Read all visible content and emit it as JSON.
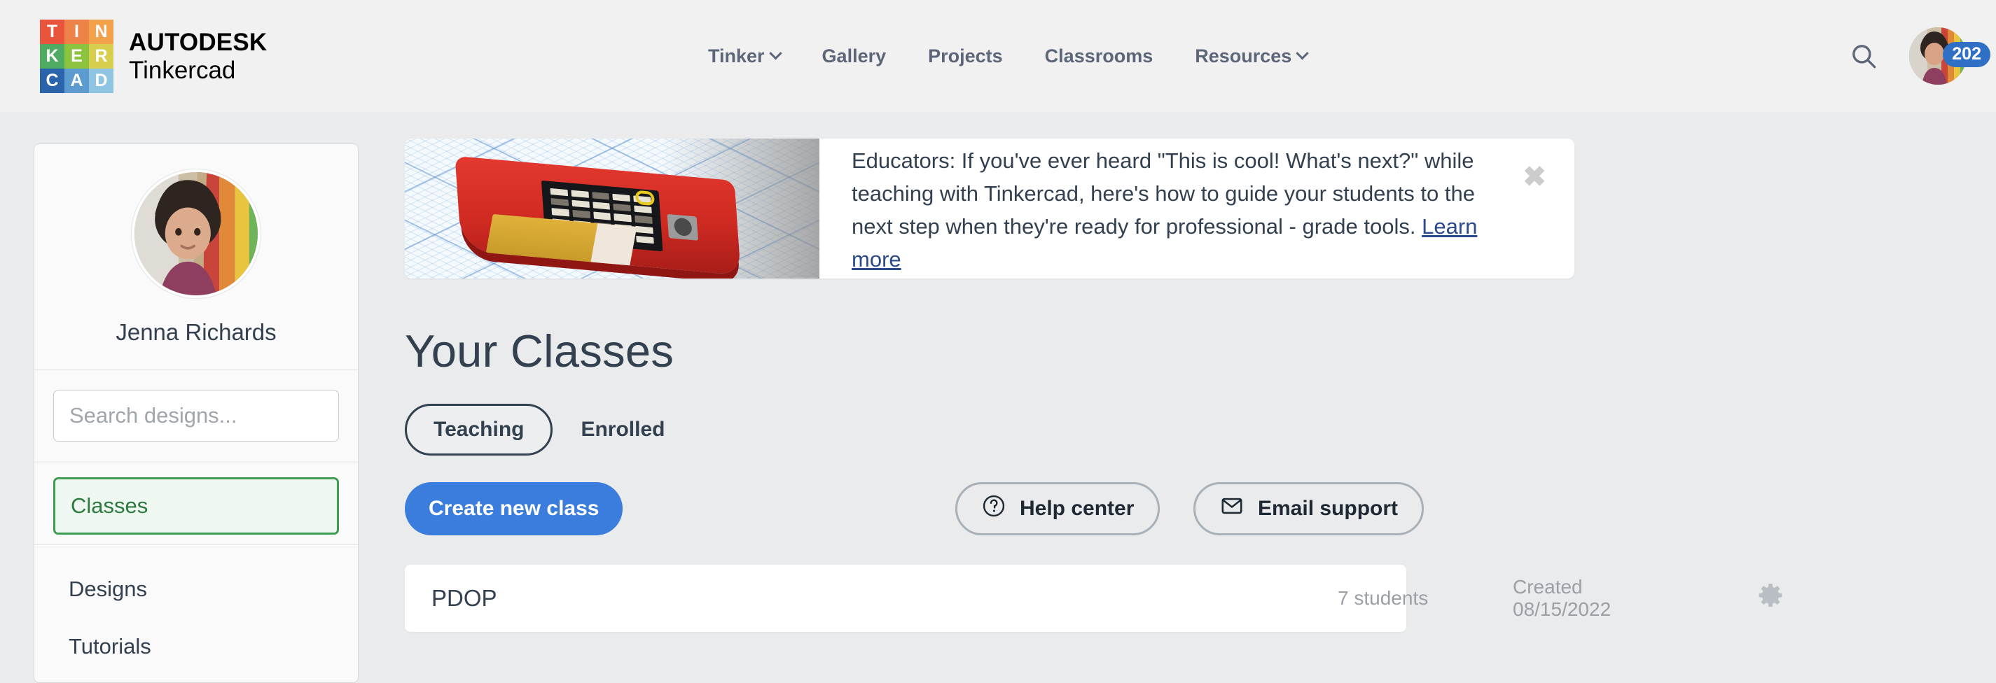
{
  "header": {
    "logo": {
      "name": "tinkercad-logo",
      "cells": [
        {
          "letter": "T",
          "color": "#e8543c"
        },
        {
          "letter": "I",
          "color": "#ef8248"
        },
        {
          "letter": "N",
          "color": "#f2a04a"
        },
        {
          "letter": "K",
          "color": "#4fab62"
        },
        {
          "letter": "E",
          "color": "#8cc440"
        },
        {
          "letter": "R",
          "color": "#d8ce4e"
        },
        {
          "letter": "C",
          "color": "#2c64ab"
        },
        {
          "letter": "A",
          "color": "#5b9bd0"
        },
        {
          "letter": "D",
          "color": "#8fc4e3"
        }
      ],
      "wordmark_top": "AUTODESK",
      "wordmark_bottom": "Tinkercad"
    },
    "nav": [
      {
        "label": "Tinker",
        "has_chevron": true
      },
      {
        "label": "Gallery",
        "has_chevron": false
      },
      {
        "label": "Projects",
        "has_chevron": false
      },
      {
        "label": "Classrooms",
        "has_chevron": false
      },
      {
        "label": "Resources",
        "has_chevron": true
      }
    ],
    "search_icon": "search-icon",
    "avatar_badge": "202",
    "badge_color": "#2f6fc4"
  },
  "sidebar": {
    "user_name": "Jenna Richards",
    "search_placeholder": "Search designs...",
    "search_value": "",
    "active_item": {
      "label": "Classes",
      "accent": "#3f9c54"
    },
    "items": [
      {
        "label": "Designs"
      },
      {
        "label": "Tutorials"
      }
    ]
  },
  "banner": {
    "text_before_link": "Educators: If you've ever heard \"This is cool! What's next?\" while teaching with Tinkercad, here's how to guide your students to the next step when they're ready for professional - grade tools. ",
    "link_label": "Learn more",
    "close_label": "✖"
  },
  "main": {
    "page_title": "Your Classes",
    "tabs": [
      {
        "label": "Teaching",
        "active": true
      },
      {
        "label": "Enrolled",
        "active": false
      }
    ],
    "create_button": "Create new class",
    "help_button": "Help center",
    "email_button": "Email support",
    "classes": [
      {
        "name": "PDOP",
        "students": "7 students",
        "created": "Created 08/15/2022",
        "settings_icon": "gear-icon"
      }
    ]
  },
  "colors": {
    "accent_blue": "#3b7ddd",
    "badge_blue": "#2f6fc4",
    "active_green": "#3f9c54",
    "page_bg": "#e9ebec",
    "header_bg": "#f1f1f1",
    "text_dark": "#33404f",
    "text_muted": "#9aa0a6"
  }
}
